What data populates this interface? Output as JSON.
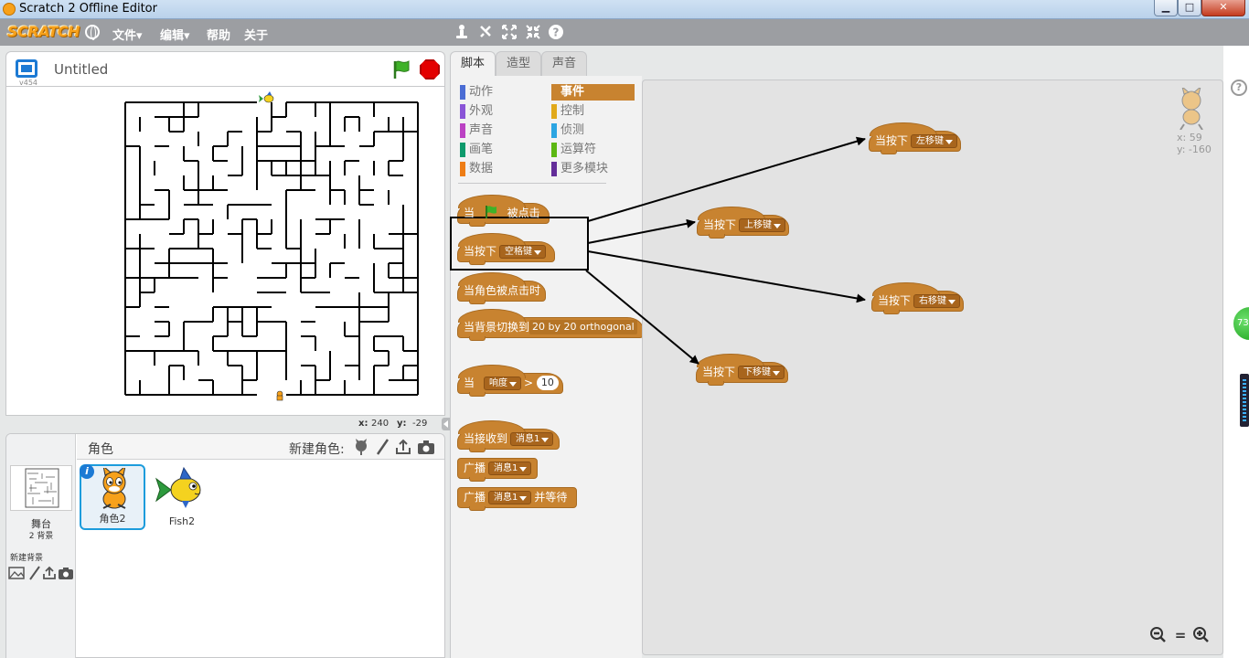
{
  "window": {
    "title": "Scratch 2 Offline Editor",
    "min": "▁",
    "max": "□",
    "close": "✕"
  },
  "menubar": {
    "logo": "SCRATCH",
    "file": "文件▾",
    "edit": "编辑▾",
    "help": "帮助",
    "about": "关于",
    "tools": [
      "duplicate-icon",
      "delete-icon",
      "grow-icon",
      "shrink-icon",
      "block-help-icon"
    ]
  },
  "stage": {
    "version": "v454",
    "project_title": "Untitled",
    "x_label": "x:",
    "x_value": "240",
    "y_label": "y:",
    "y_value": "-29"
  },
  "sprites_pane": {
    "title": "角色",
    "new_sprite": "新建角色:",
    "stage_label": "舞台",
    "stage_backdrops": "2 背景",
    "new_backdrop": "新建背景",
    "sprites": [
      {
        "name": "角色2",
        "selected": true
      },
      {
        "name": "Fish2",
        "selected": false
      }
    ]
  },
  "tabs": {
    "scripts": "脚本",
    "costumes": "造型",
    "sounds": "声音"
  },
  "categories": [
    {
      "label": "动作",
      "color": "#4a6cd4"
    },
    {
      "label": "外观",
      "color": "#8a55d7"
    },
    {
      "label": "声音",
      "color": "#bb42c3"
    },
    {
      "label": "画笔",
      "color": "#0e9a6c"
    },
    {
      "label": "数据",
      "color": "#ee7d16"
    },
    {
      "label": "事件",
      "color": "#c88330"
    },
    {
      "label": "控制",
      "color": "#e1a91a"
    },
    {
      "label": "侦测",
      "color": "#2ca5e2"
    },
    {
      "label": "运算符",
      "color": "#5cb712"
    },
    {
      "label": "更多模块",
      "color": "#632d99"
    }
  ],
  "palette_blocks": {
    "flag_when": "当",
    "flag_clicked": "被点击",
    "key_pressed": "当按下",
    "key_space": "空格键",
    "sprite_clicked": "当角色被点击时",
    "backdrop_switch": "当背景切换到",
    "backdrop_name": "20 by 20 orthogonal",
    "sensor_when": "当",
    "sensor_name": "响度",
    "sensor_gt": ">",
    "sensor_value": "10",
    "receive": "当接收到",
    "message1": "消息1",
    "broadcast": "广播",
    "broadcast_wait": "并等待"
  },
  "script_blocks": {
    "key_pressed": "当按下",
    "left": "左移键",
    "up": "上移键",
    "right": "右移键",
    "down": "下移键"
  },
  "script_area": {
    "x_label": "x:",
    "x_value": "59",
    "y_label": "y:",
    "y_value": "-160",
    "zoom_out": "−",
    "zoom_reset": "=",
    "zoom_in": "+"
  },
  "right_edge": {
    "help": "?",
    "badge": "73"
  },
  "colors": {
    "events": "#c88330",
    "menubar": "#9c9ea2",
    "accent": "#1c7ad4"
  }
}
